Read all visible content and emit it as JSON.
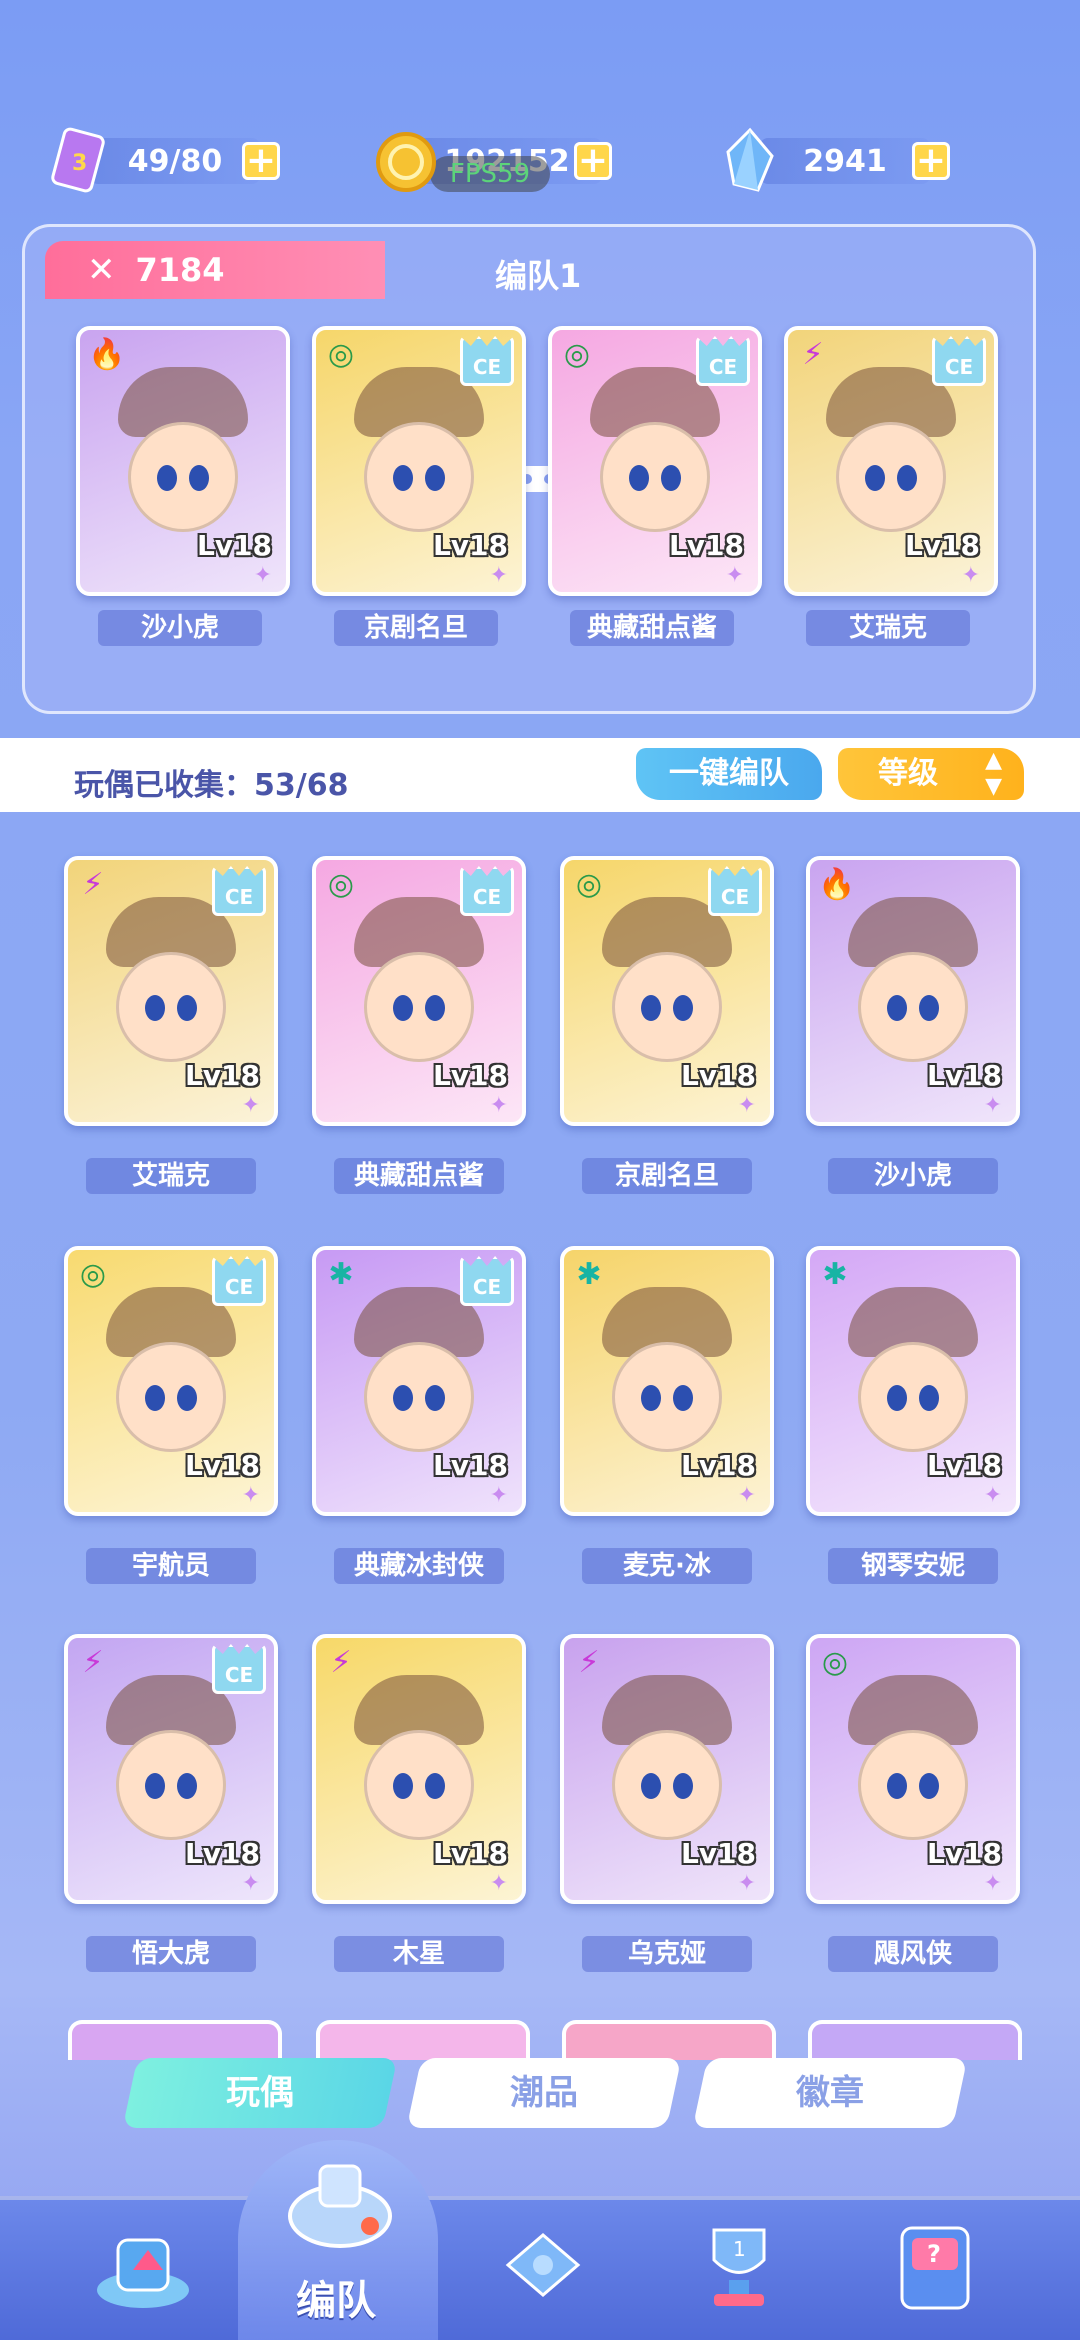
{
  "resources": [
    {
      "name": "stamina",
      "value": "49/80",
      "icon": "stamina-card-icon",
      "plus": "+"
    },
    {
      "name": "coins",
      "value": "192152",
      "icon": "gold-coin-icon",
      "plus": "+"
    },
    {
      "name": "crystals",
      "value": "2941",
      "icon": "crystal-icon",
      "plus": "+"
    }
  ],
  "fps_overlay": "FPS59",
  "team": {
    "power": "7184",
    "title": "编队1",
    "members": [
      {
        "name": "沙小虎",
        "level": "Lv18",
        "element": "fire",
        "ce": false,
        "color": "#c9a4f0"
      },
      {
        "name": "京剧名旦",
        "level": "Lv18",
        "element": "wind",
        "ce": true,
        "color": "#f6d66a"
      },
      {
        "name": "典藏甜点酱",
        "level": "Lv18",
        "element": "wind",
        "ce": true,
        "color": "#f5a8e2"
      },
      {
        "name": "艾瑞克",
        "level": "Lv18",
        "element": "thunder",
        "ce": true,
        "color": "#f2d47a"
      }
    ],
    "page_dots": 4,
    "active_dot": 0
  },
  "collection": {
    "label": "玩偶已收集：53/68",
    "one_click_team": "一键编队",
    "sort": "等级"
  },
  "dolls": [
    {
      "name": "艾瑞克",
      "level": "Lv18",
      "element": "thunder",
      "ce": true,
      "color": "#f2d47a"
    },
    {
      "name": "典藏甜点酱",
      "level": "Lv18",
      "element": "wind",
      "ce": true,
      "color": "#f5a8e2"
    },
    {
      "name": "京剧名旦",
      "level": "Lv18",
      "element": "wind",
      "ce": true,
      "color": "#f6d66a"
    },
    {
      "name": "沙小虎",
      "level": "Lv18",
      "element": "fire",
      "ce": false,
      "color": "#c9a4f0"
    },
    {
      "name": "宇航员",
      "level": "Lv18",
      "element": "wind",
      "ce": true,
      "color": "#f8da70"
    },
    {
      "name": "典藏冰封侠",
      "level": "Lv18",
      "element": "ice",
      "ce": true,
      "color": "#c79af4"
    },
    {
      "name": "麦克·冰",
      "level": "Lv18",
      "element": "ice",
      "ce": false,
      "color": "#f6d46a"
    },
    {
      "name": "钢琴安妮",
      "level": "Lv18",
      "element": "ice",
      "ce": false,
      "color": "#d4a8f6"
    },
    {
      "name": "悟大虎",
      "level": "Lv18",
      "element": "thunder",
      "ce": true,
      "color": "#c3a6f2"
    },
    {
      "name": "木星",
      "level": "Lv18",
      "element": "thunder",
      "ce": false,
      "color": "#f7d868"
    },
    {
      "name": "乌克娅",
      "level": "Lv18",
      "element": "thunder",
      "ce": false,
      "color": "#c8a2ee"
    },
    {
      "name": "飓风侠",
      "level": "Lv18",
      "element": "wind",
      "ce": false,
      "color": "#cda6f4"
    }
  ],
  "element_glyphs": {
    "fire": "🔥",
    "wind": "◎",
    "thunder": "⚡",
    "ice": "✱"
  },
  "element_colors": {
    "fire": "#e83a2a",
    "wind": "#2a9a4a",
    "thunder": "#c83ad8",
    "ice": "#18b4a4"
  },
  "ce_label": "CE",
  "tabs": [
    {
      "label": "玩偶",
      "active": true
    },
    {
      "label": "潮品",
      "active": false
    },
    {
      "label": "徽章",
      "active": false
    }
  ],
  "nav": {
    "active_label": "编队",
    "items": [
      "home-arrow-icon",
      "team-whistle-icon",
      "gamepad-icon",
      "trophy-icon",
      "gacha-machine-icon"
    ]
  }
}
